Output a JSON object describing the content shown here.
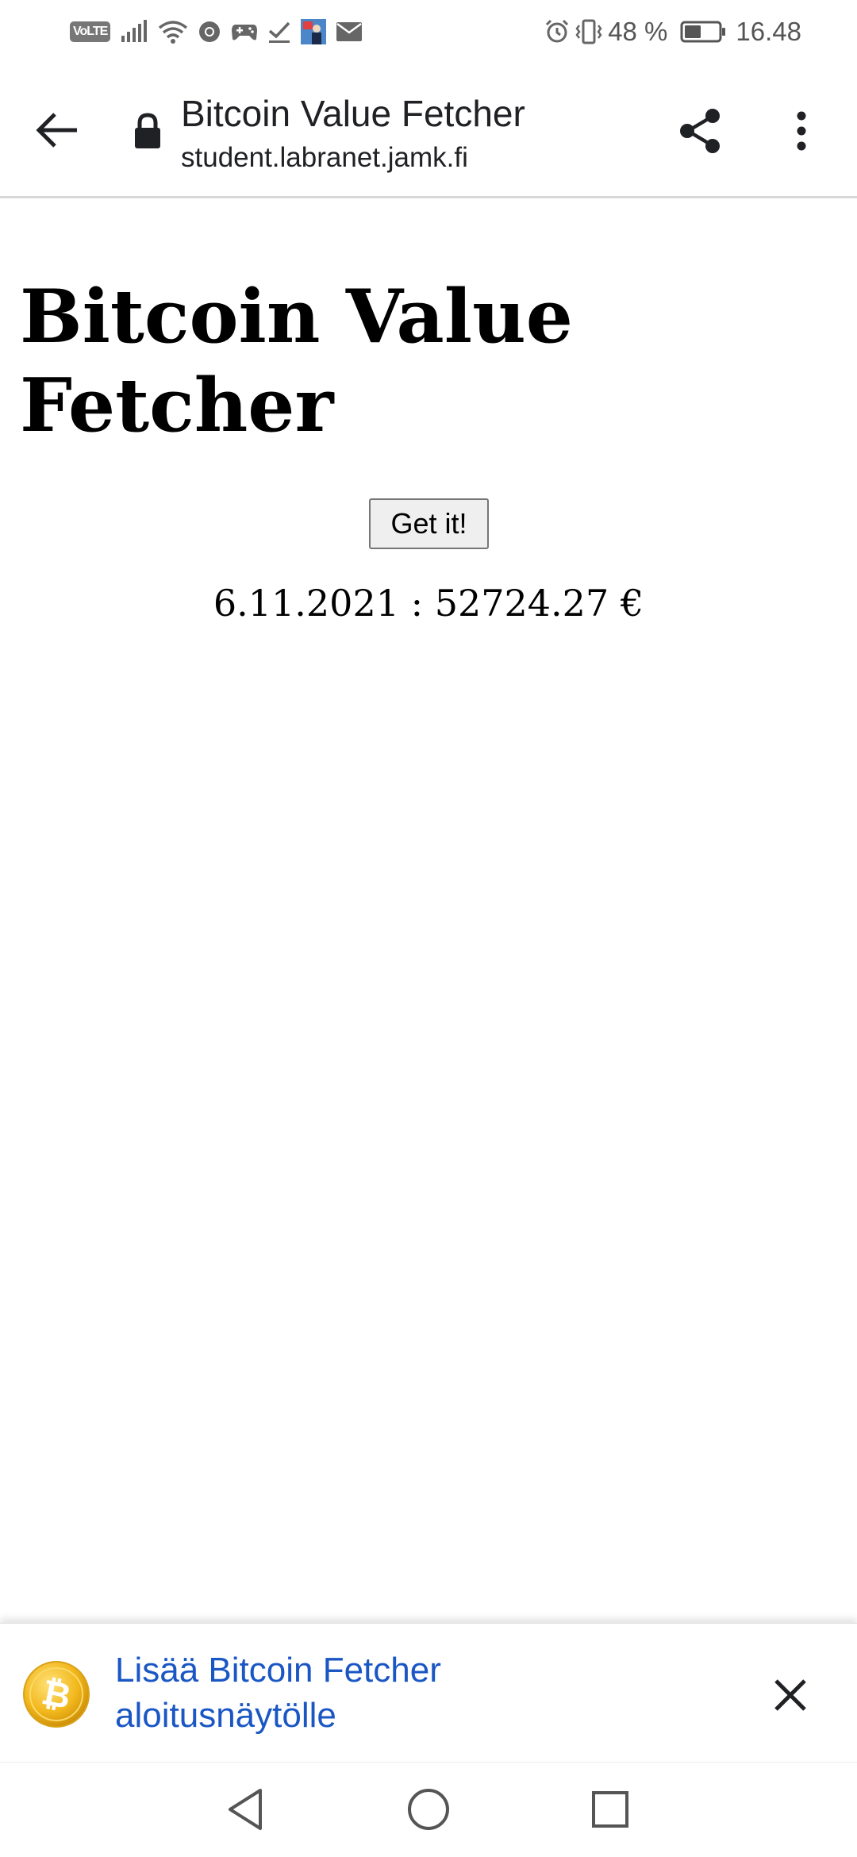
{
  "status_bar": {
    "battery_text": "48 %",
    "time": "16.48",
    "volte_label": "VoLTE",
    "left_icons": [
      "volte-icon",
      "signal-icon",
      "wifi-icon",
      "chrome-icon",
      "gamepad-icon",
      "check-icon",
      "app-thumbnail-icon",
      "mail-icon"
    ],
    "right_icons": [
      "alarm-icon",
      "vibrate-icon",
      "battery-icon"
    ],
    "battery_level": 0.48
  },
  "toolbar": {
    "title": "Bitcoin Value Fetcher",
    "url": "student.labranet.jamk.fi",
    "icons": [
      "back-arrow-icon",
      "lock-icon",
      "share-icon",
      "more-vert-icon"
    ]
  },
  "page": {
    "heading": "Bitcoin Value Fetcher",
    "button_label": "Get it!",
    "result": "6.11.2021 : 52724.27 €"
  },
  "add_to_home": {
    "text": "Lisää Bitcoin Fetcher aloitusnäytölle",
    "icon": "bitcoin-icon",
    "close_icon": "close-icon"
  },
  "nav_bar": {
    "icons": [
      "nav-back-icon",
      "nav-home-icon",
      "nav-recents-icon"
    ]
  },
  "colors": {
    "link_blue": "#1a56c4",
    "bitcoin_gold": "#f2b81c",
    "button_bg": "#efefef"
  }
}
